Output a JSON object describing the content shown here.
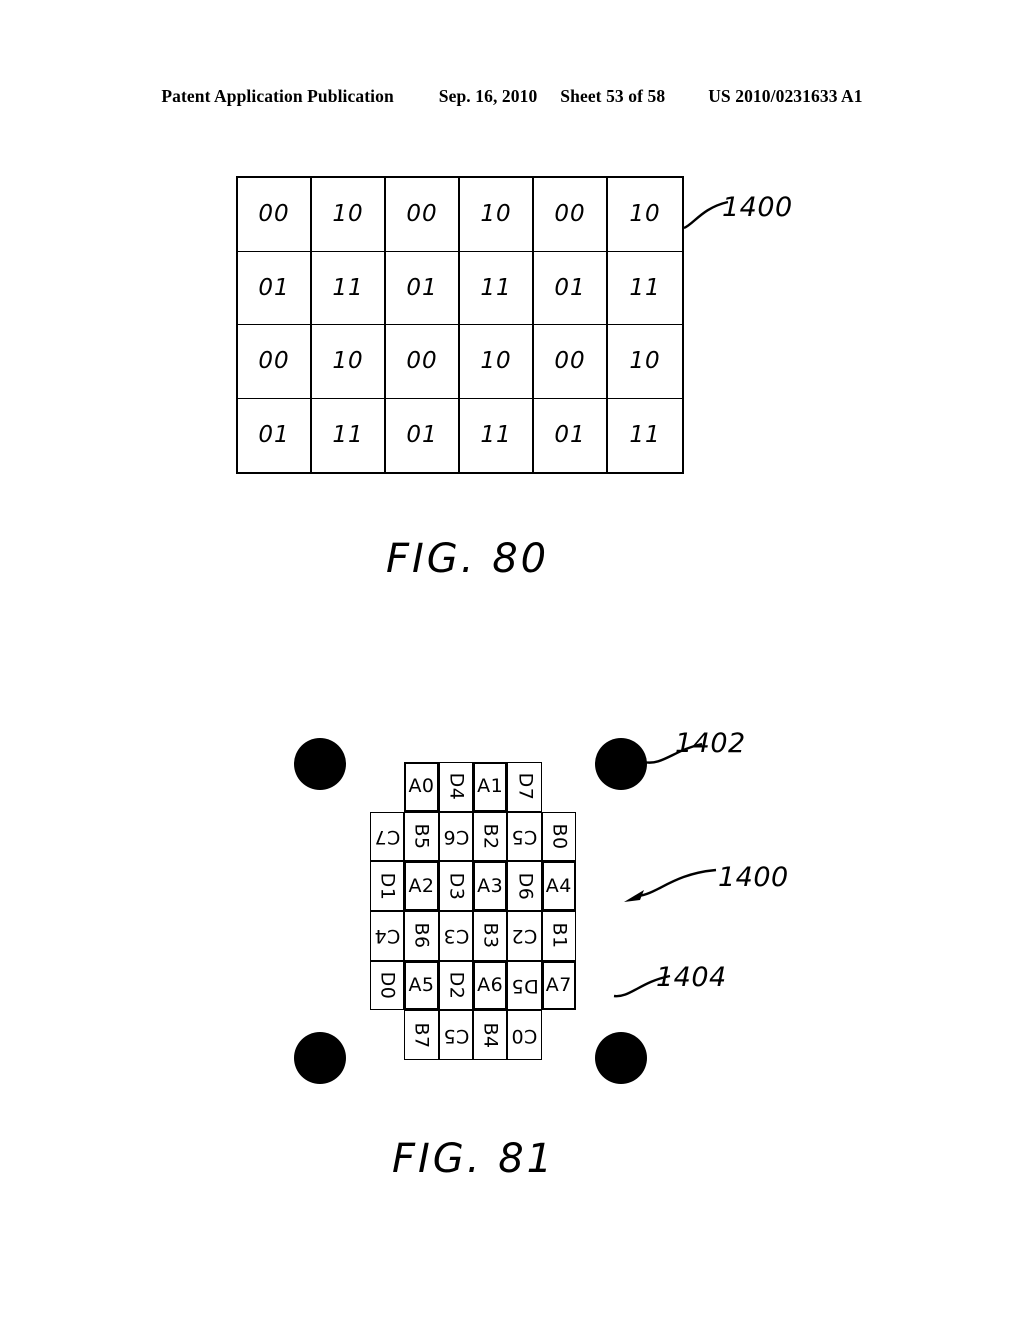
{
  "header": {
    "publication": "Patent Application Publication",
    "date": "Sep. 16, 2010",
    "sheet": "Sheet 53 of 58",
    "number": "US 2010/0231633 A1"
  },
  "figures": [
    {
      "id": "fig80",
      "caption": "FIG. 80",
      "reference_labels": [
        {
          "text": "1400",
          "target": "tile-grid"
        }
      ],
      "grid": {
        "columns": 6,
        "rows": 4,
        "cells": [
          [
            "00",
            "10",
            "00",
            "10",
            "00",
            "10"
          ],
          [
            "01",
            "11",
            "01",
            "11",
            "01",
            "11"
          ],
          [
            "00",
            "10",
            "00",
            "10",
            "00",
            "10"
          ],
          [
            "01",
            "11",
            "01",
            "11",
            "01",
            "11"
          ]
        ]
      }
    },
    {
      "id": "fig81",
      "caption": "FIG. 81",
      "reference_labels": [
        {
          "text": "1402",
          "target": "corner-dot"
        },
        {
          "text": "1400",
          "target": "tag-region"
        },
        {
          "text": "1404",
          "target": "cell-a7"
        }
      ],
      "corner_dots": 4,
      "grid": {
        "columns": 6,
        "rows": 6,
        "cells": [
          [
            {
              "label": "",
              "rotation": 0,
              "thick": false,
              "empty": true
            },
            {
              "label": "A0",
              "rotation": 0,
              "thick": true,
              "empty": false
            },
            {
              "label": "D4",
              "rotation": 90,
              "thick": false,
              "empty": false
            },
            {
              "label": "A1",
              "rotation": 0,
              "thick": true,
              "empty": false
            },
            {
              "label": "D7",
              "rotation": 90,
              "thick": false,
              "empty": false
            },
            {
              "label": "",
              "rotation": 0,
              "thick": false,
              "empty": true
            }
          ],
          [
            {
              "label": "C7",
              "rotation": 180,
              "thick": false,
              "empty": false
            },
            {
              "label": "B5",
              "rotation": 90,
              "thick": false,
              "empty": false
            },
            {
              "label": "C6",
              "rotation": 180,
              "thick": false,
              "empty": false
            },
            {
              "label": "B2",
              "rotation": 90,
              "thick": false,
              "empty": false
            },
            {
              "label": "C5",
              "rotation": 180,
              "thick": false,
              "empty": false
            },
            {
              "label": "B0",
              "rotation": 90,
              "thick": false,
              "empty": false
            }
          ],
          [
            {
              "label": "D1",
              "rotation": 90,
              "thick": false,
              "empty": false
            },
            {
              "label": "A2",
              "rotation": 0,
              "thick": true,
              "empty": false
            },
            {
              "label": "D3",
              "rotation": 90,
              "thick": false,
              "empty": false
            },
            {
              "label": "A3",
              "rotation": 0,
              "thick": true,
              "empty": false
            },
            {
              "label": "D6",
              "rotation": 90,
              "thick": false,
              "empty": false
            },
            {
              "label": "A4",
              "rotation": 0,
              "thick": true,
              "empty": false
            }
          ],
          [
            {
              "label": "C4",
              "rotation": 180,
              "thick": false,
              "empty": false
            },
            {
              "label": "B6",
              "rotation": 90,
              "thick": false,
              "empty": false
            },
            {
              "label": "C3",
              "rotation": 180,
              "thick": false,
              "empty": false
            },
            {
              "label": "B3",
              "rotation": 90,
              "thick": false,
              "empty": false
            },
            {
              "label": "C2",
              "rotation": 180,
              "thick": false,
              "empty": false
            },
            {
              "label": "B1",
              "rotation": 90,
              "thick": false,
              "empty": false
            }
          ],
          [
            {
              "label": "D0",
              "rotation": 90,
              "thick": false,
              "empty": false
            },
            {
              "label": "A5",
              "rotation": 0,
              "thick": true,
              "empty": false
            },
            {
              "label": "D2",
              "rotation": 90,
              "thick": false,
              "empty": false
            },
            {
              "label": "A6",
              "rotation": 0,
              "thick": true,
              "empty": false
            },
            {
              "label": "D5",
              "rotation": 180,
              "thick": false,
              "empty": false
            },
            {
              "label": "A7",
              "rotation": 0,
              "thick": true,
              "empty": false
            }
          ],
          [
            {
              "label": "",
              "rotation": 0,
              "thick": false,
              "empty": true
            },
            {
              "label": "B7",
              "rotation": 90,
              "thick": false,
              "empty": false
            },
            {
              "label": "C5",
              "rotation": 180,
              "thick": false,
              "empty": false
            },
            {
              "label": "B4",
              "rotation": 90,
              "thick": false,
              "empty": false
            },
            {
              "label": "C0",
              "rotation": 180,
              "thick": false,
              "empty": false
            },
            {
              "label": "",
              "rotation": 0,
              "thick": false,
              "empty": true
            }
          ]
        ]
      }
    }
  ],
  "colors": {
    "ink": "#000000",
    "page": "#ffffff"
  }
}
